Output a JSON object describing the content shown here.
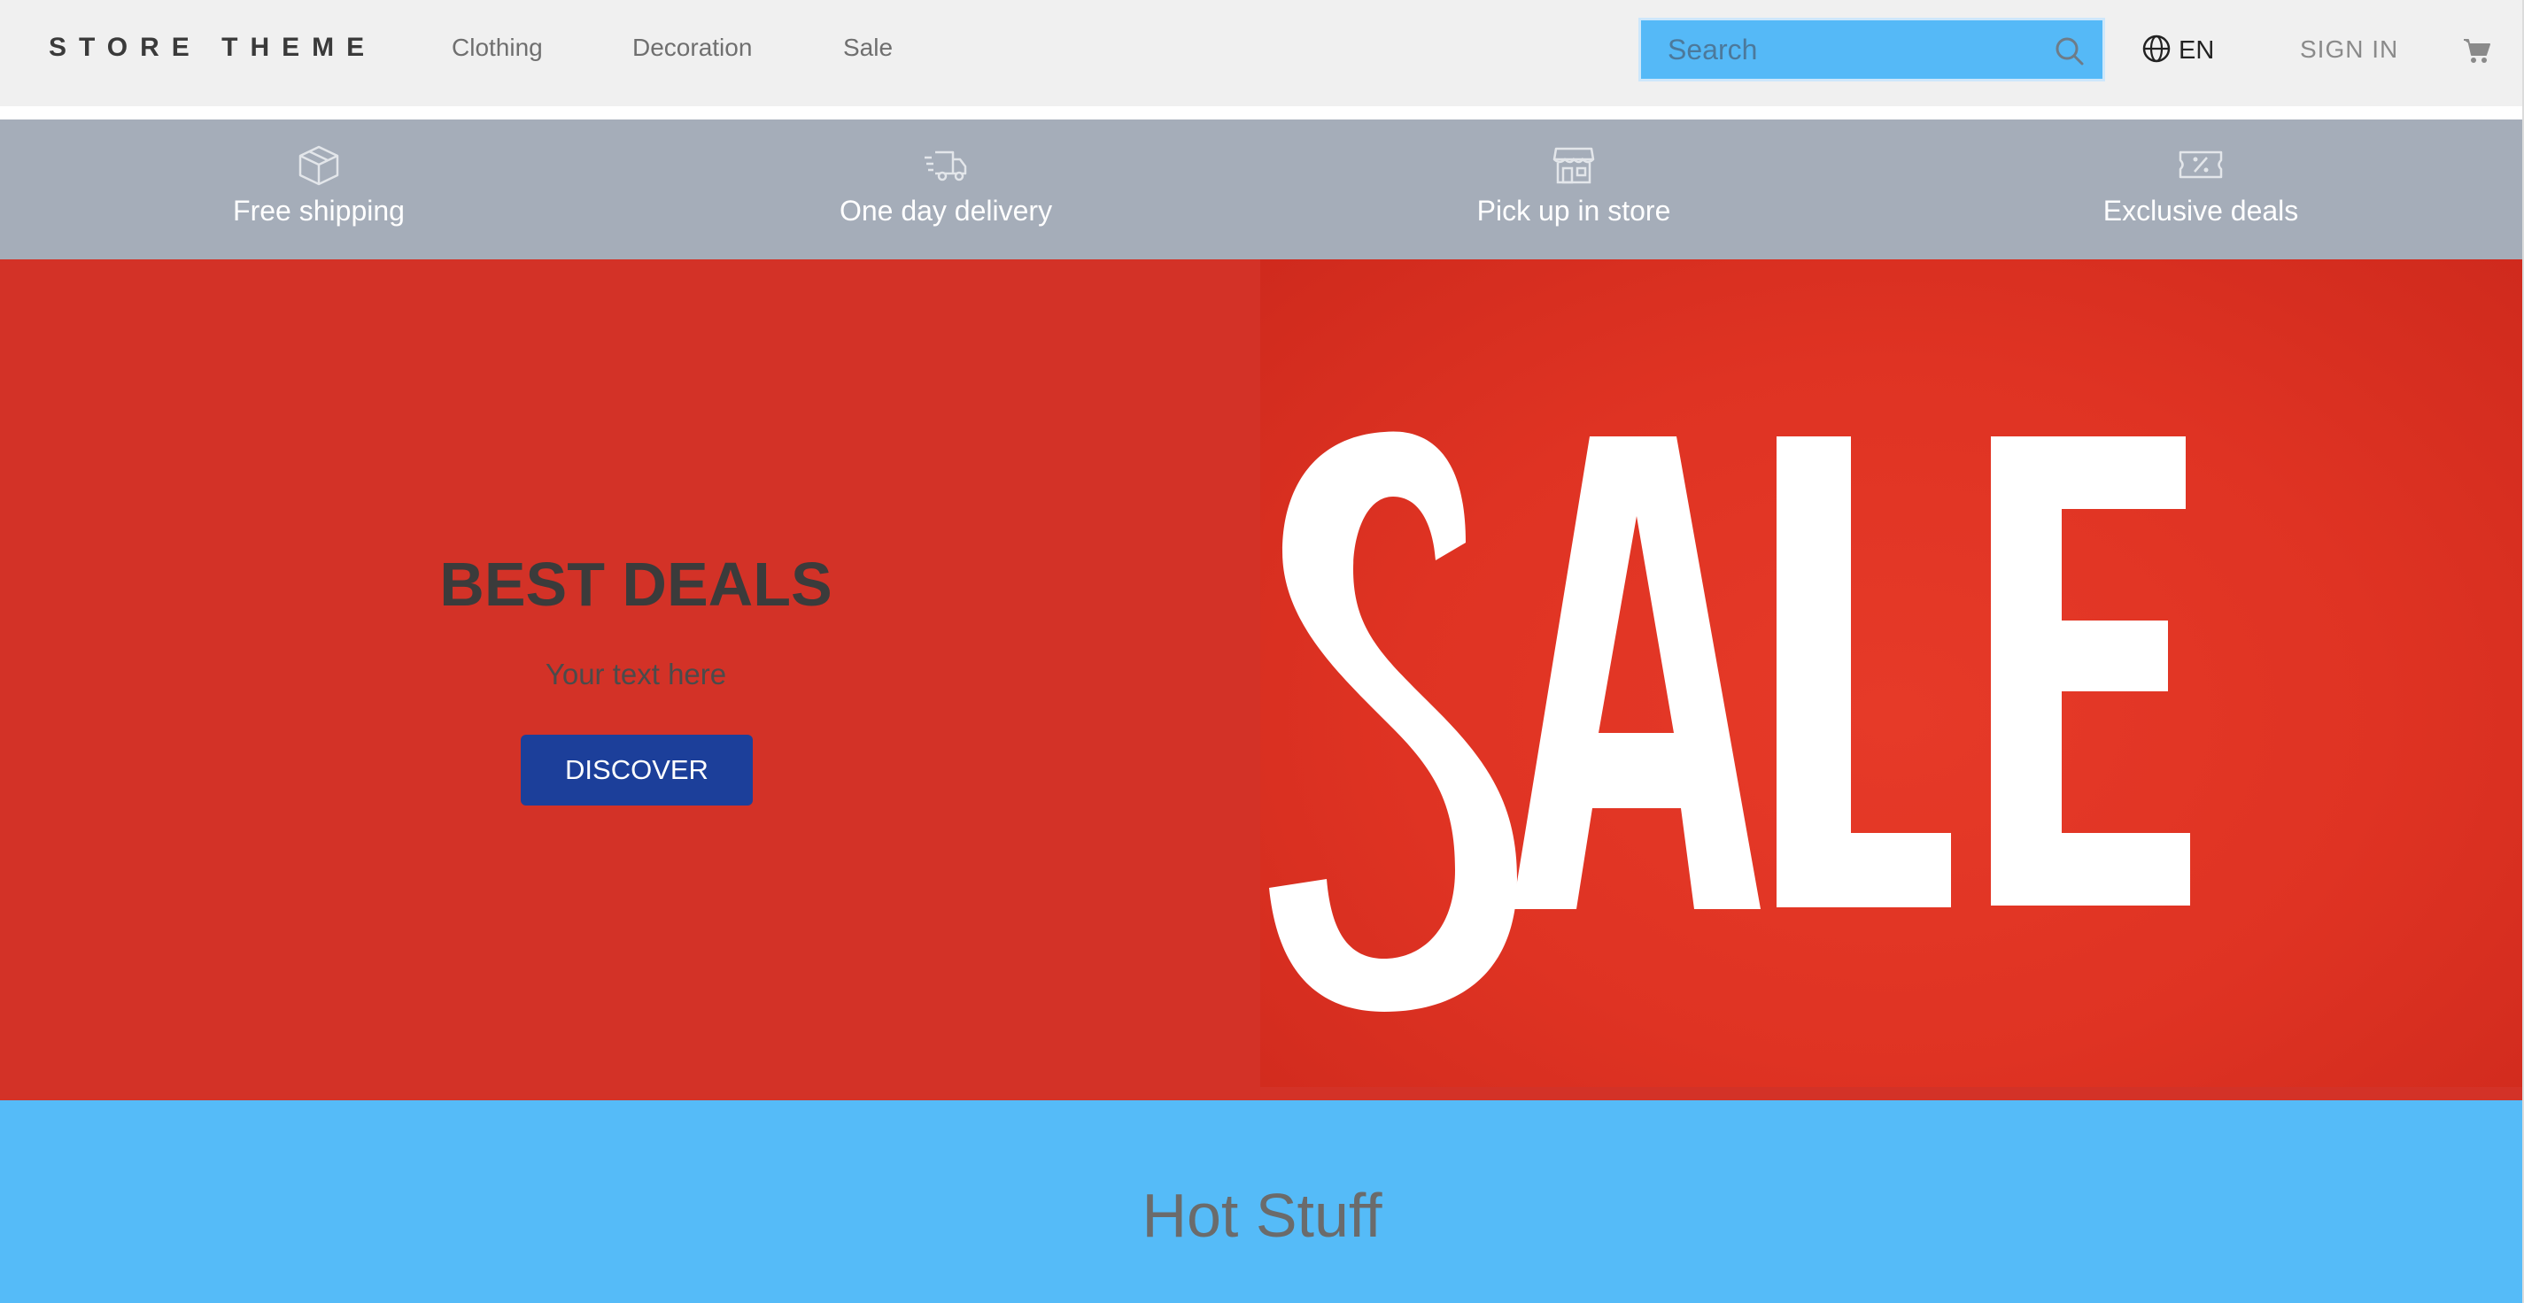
{
  "header": {
    "logo": "STORE THEME",
    "nav": [
      {
        "label": "Clothing"
      },
      {
        "label": "Decoration"
      },
      {
        "label": "Sale"
      }
    ],
    "search": {
      "placeholder": "Search",
      "value": ""
    },
    "language": "EN",
    "sign_in": "SIGN IN",
    "icons": [
      "search-icon",
      "globe-icon",
      "cart-icon"
    ]
  },
  "features": [
    {
      "label": "Free shipping",
      "icon": "box-icon"
    },
    {
      "label": "One day delivery",
      "icon": "delivery-truck-icon"
    },
    {
      "label": "Pick up in store",
      "icon": "store-icon"
    },
    {
      "label": "Exclusive deals",
      "icon": "coupon-icon"
    }
  ],
  "hero": {
    "title": "BEST DEALS",
    "subtitle": "Your text here",
    "button": "DISCOVER",
    "image_text": "SALE"
  },
  "section": {
    "title": "Hot Stuff"
  },
  "colors": {
    "header_bg": "#f0f0f0",
    "features_bg": "#a5adb9",
    "hero_bg": "#d33227",
    "button_bg": "#1c3f9a",
    "search_bg": "#55b9f7",
    "hot_bg": "#55bbf8"
  }
}
